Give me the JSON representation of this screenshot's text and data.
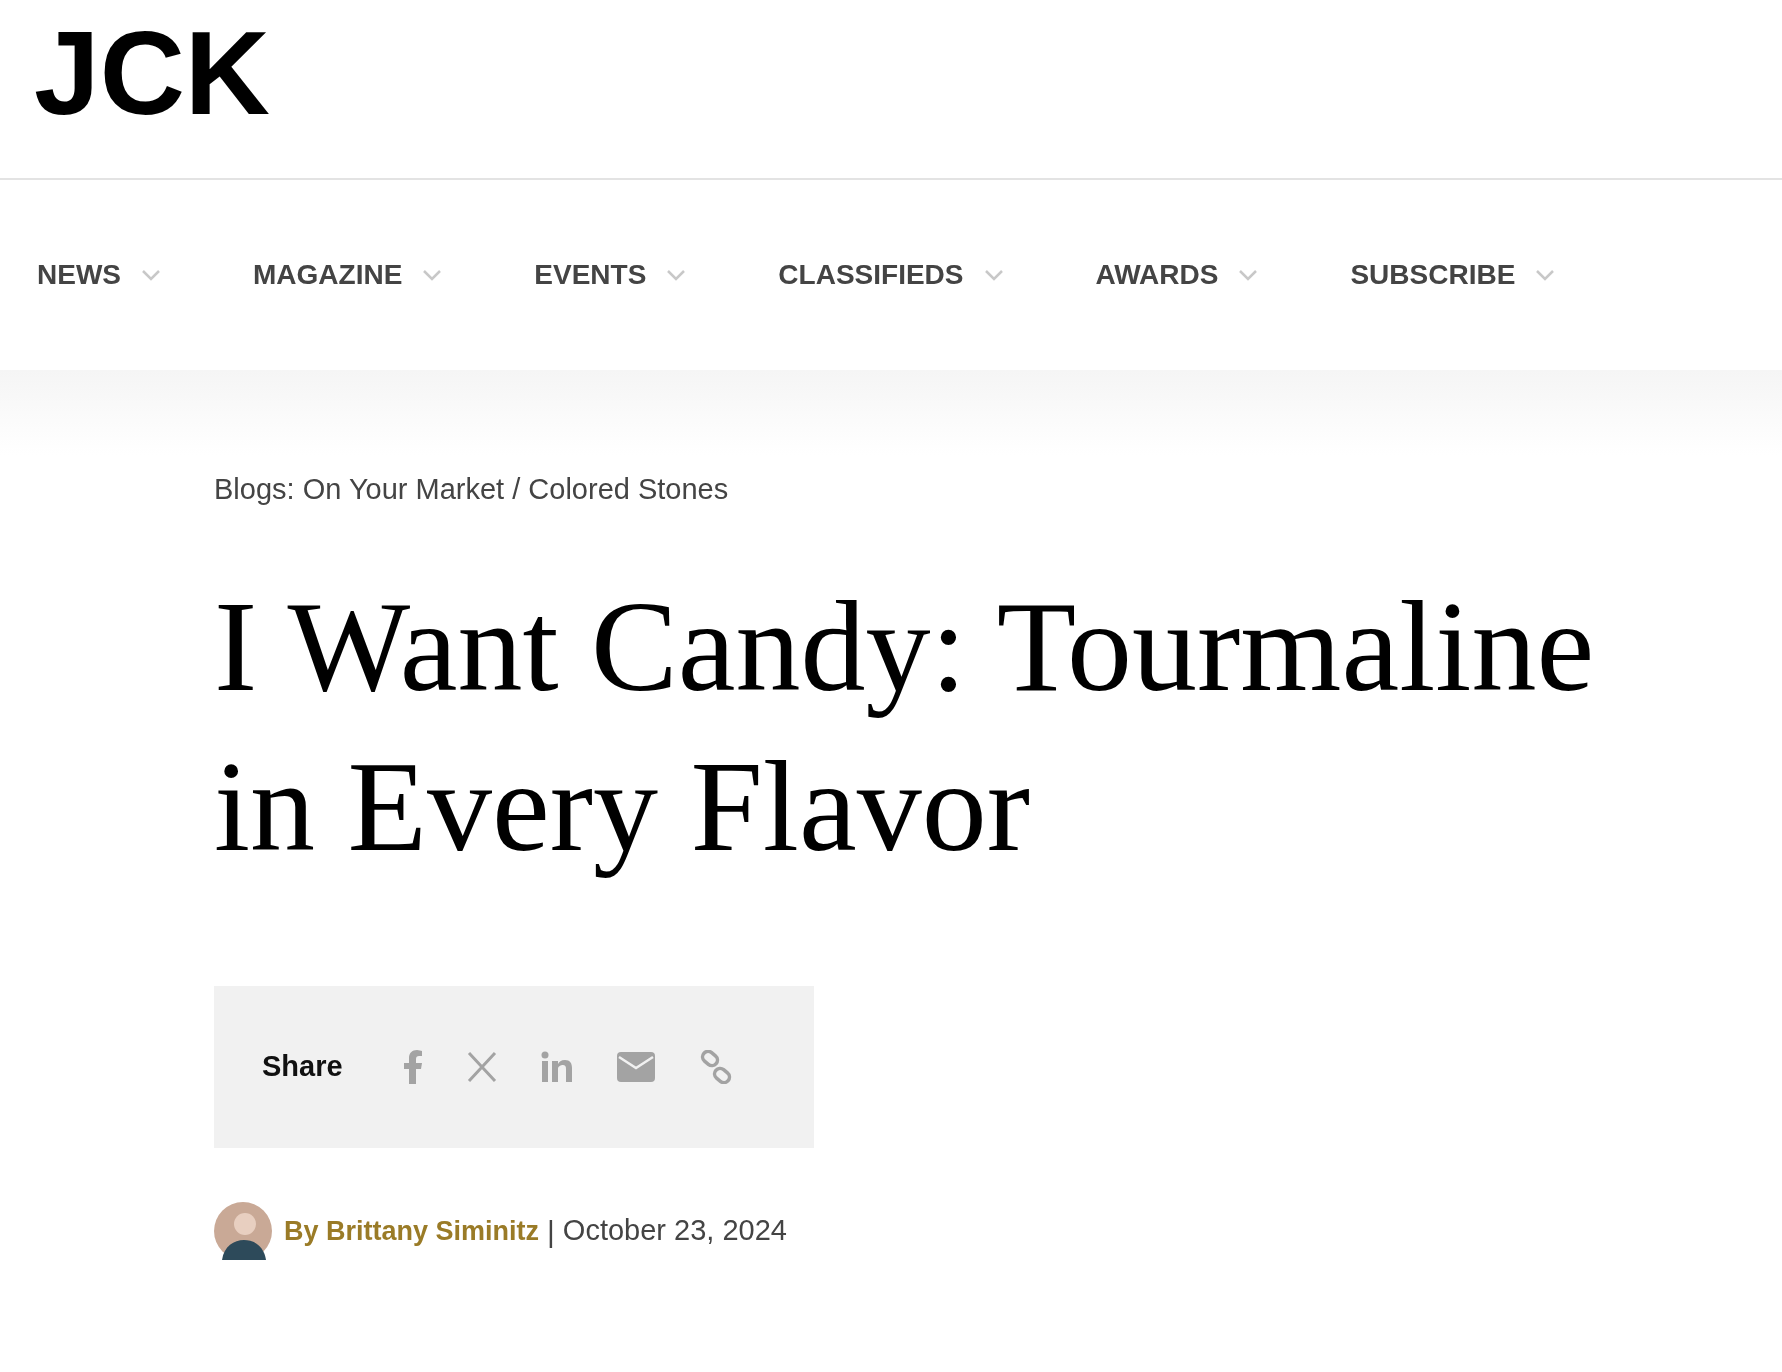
{
  "logo": "JCK",
  "nav": [
    {
      "label": "NEWS"
    },
    {
      "label": "MAGAZINE"
    },
    {
      "label": "EVENTS"
    },
    {
      "label": "CLASSIFIEDS"
    },
    {
      "label": "AWARDS"
    },
    {
      "label": "SUBSCRIBE"
    }
  ],
  "breadcrumb": "Blogs: On Your Market / Colored Stones",
  "title": "I Want Candy: Tourmaline in Every Flavor",
  "share": {
    "label": "Share",
    "icons": [
      {
        "kind": "facebook"
      },
      {
        "kind": "x"
      },
      {
        "kind": "linkedin"
      },
      {
        "kind": "email"
      },
      {
        "kind": "link"
      }
    ]
  },
  "byline": {
    "author": "By Brittany Siminitz",
    "separator": "|",
    "date": "October 23, 2024"
  }
}
